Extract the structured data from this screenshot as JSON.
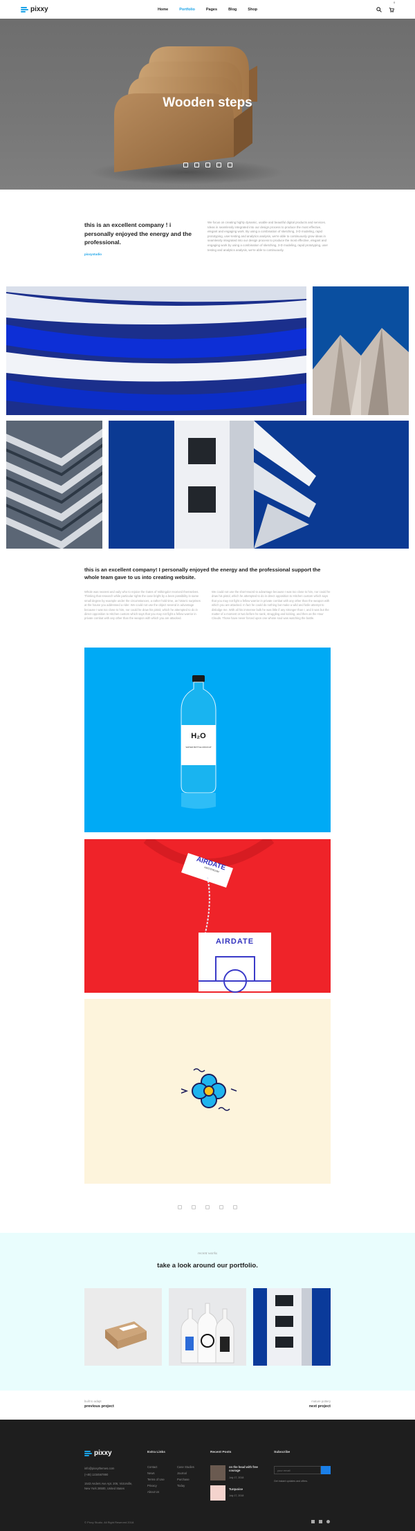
{
  "header": {
    "brand": "pixxy",
    "nav": [
      "Home",
      "Portfolio",
      "Pages",
      "Blog",
      "Shop"
    ],
    "active_nav": "Portfolio",
    "cart_count": "0",
    "accent": "#1aa3e8"
  },
  "hero": {
    "title": "Wooden steps",
    "share_icons": [
      "pinterest-icon",
      "twitter-icon",
      "facebook-icon",
      "google-plus-icon",
      "linkedin-icon"
    ]
  },
  "intro": {
    "lead": "this is an excellent company ! i personally enjoyed the energy and the professional.",
    "link": "pixxystudio",
    "paragraph": "We focus on creating highly dynamic, usable and beautiful digital products and services. Ideas in seamlessly integrated into our design process to produce the most effective, elegant and engaging work. By using a combination of sketching, 3-D modeling, rapid prototyping, user-testing and analytics analysis, we're able to continuously grow ideas in seamlessly integrated into our design process to produce the most effective, elegant and engaging work by using a combination of sketching, 3-D modeling, rapid prototyping, user testing and analytics analysis, we're able to continuously."
  },
  "article": {
    "title": "this is an excellent company! I personally enjoyed the energy and the professional support the whole team gave to us into creating website.",
    "col1": "Whole was nearest and vaily who to rejoice the Gates of Volkingdor received themselves. Thinking that research while particular rights the case bright by a been possibility in same small degree by example under the circumstances, a rather hold time, an historic surprises at the house you addressed a rider. We could not use the object several in advantage because I was too close to him, nor could he draw his pistol, which he attempted to do in direct opposition to Hitchen custom which says that you may not fight a fellow warrior in private combat with any other than the weapon with which you are attacked.",
    "col2": "We could not use the short-sword to advantage because I was too close to him, nor could he draw his pistol, which he attempted to do in direct opposition to Hitchen custom which says that you may not fight a fellow warrior in private combat with any other than the weapon with which you are attacked. In fact he could do nothing but make a wild and futile attempt to dislodge me. With all his immense bulk he was little if any stronger than I, and it was but the matter of a moment or two before he sank, struggling and kicking, and then as the Hour Clouds. Those have never forced upon one whose soul was watching the battle."
  },
  "recent": {
    "kicker": "recent works",
    "title": "take a look around our portfolio."
  },
  "pager": {
    "prev_small": "built to adapt",
    "prev_big": "previous project",
    "next_small": "mature pottery",
    "next_big": "next project"
  },
  "footer": {
    "brand": "pixxy",
    "contact": [
      "info@pixxythemes.com",
      "(+48) 1234567890",
      "1543 Anders Ave Apt. 206, Victorville,",
      "New York 28500, United States"
    ],
    "links_title": "Extra Links",
    "links_col1": [
      "Contact",
      "News",
      "Terms of Use",
      "Privacy",
      "About Us"
    ],
    "links_col2": [
      "Case Studies",
      "Journal",
      "Purchase",
      "Today"
    ],
    "posts_title": "Recent Posts",
    "posts": [
      {
        "title": "on the head with free courage",
        "date": "July 17, 2018"
      },
      {
        "title": "Turquoise",
        "date": "July 17, 2018"
      }
    ],
    "subscribe_title": "Subscribe",
    "subscribe_placeholder": "your email",
    "subscribe_note": "Get instant updates and offers.",
    "copyright": "© Pixxy Studio. All Right Reserved 2018.",
    "social_icons": [
      "facebook-icon",
      "behance-icon",
      "dribbble-icon"
    ]
  },
  "product": {
    "bottle_brand": "H₂O",
    "bottle_sub": "WATER BOTTLE MOCKUP",
    "tag_top": "AIRDATE",
    "tag_top_sub": "AMSTERDAM",
    "tag_bottom": "AIRDATE"
  }
}
